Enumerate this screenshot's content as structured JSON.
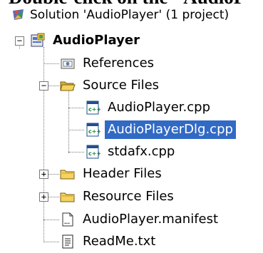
{
  "caption": {
    "text": "Double-click on the \"AudioP"
  },
  "tree": {
    "solution": "Solution 'AudioPlayer' (1 project)",
    "project": "AudioPlayer",
    "items": [
      {
        "label": "References"
      },
      {
        "label": "Source Files"
      },
      {
        "label": "AudioPlayer.cpp"
      },
      {
        "label": "AudioPlayerDlg.cpp"
      },
      {
        "label": "stdafx.cpp"
      },
      {
        "label": "Header Files"
      },
      {
        "label": "Resource Files"
      },
      {
        "label": "AudioPlayer.manifest"
      },
      {
        "label": "ReadMe.txt"
      }
    ],
    "expanders": {
      "minus": "−",
      "plus": "+"
    }
  },
  "colors": {
    "selection": "#316ac5",
    "folder": "#f4d35e"
  }
}
